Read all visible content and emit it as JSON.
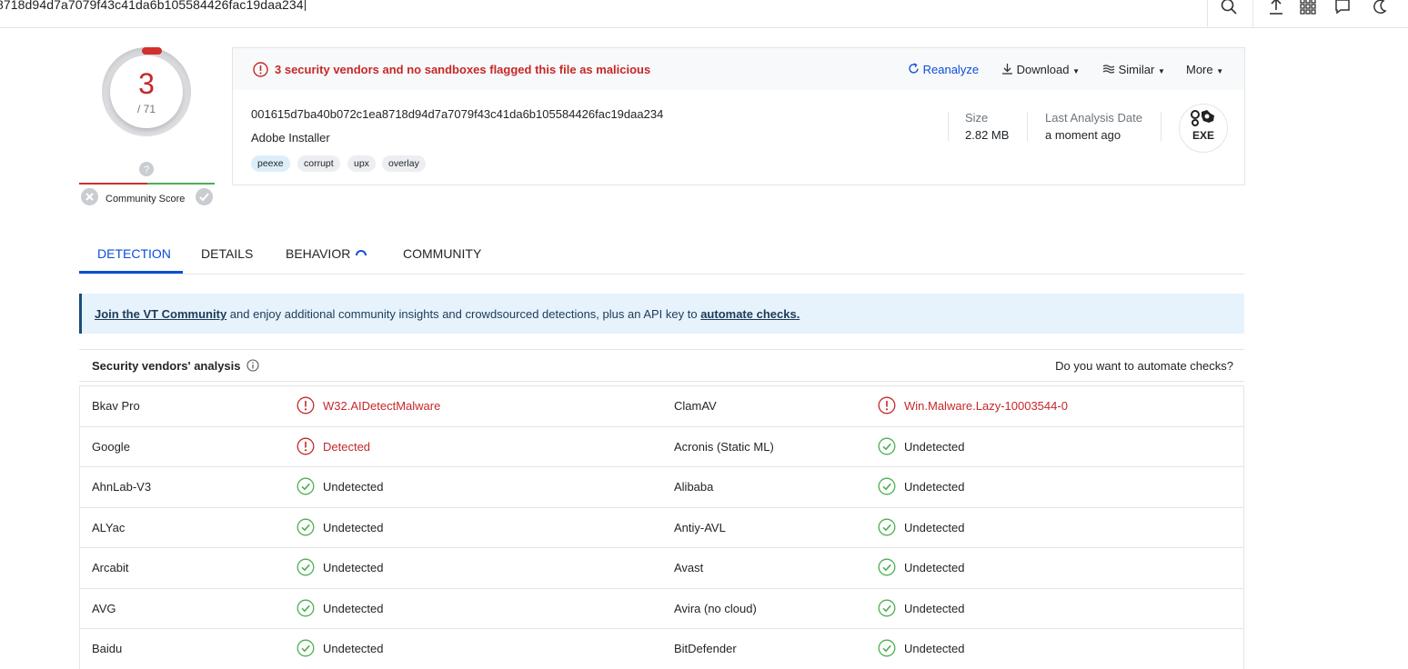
{
  "topbar": {
    "search_value": "8718d94d7a7079f43c41da6b105584426fac19daa234",
    "icons": [
      "search-icon",
      "upload-icon",
      "apps-grid-icon",
      "chat-icon",
      "theme-icon"
    ]
  },
  "score": {
    "detections": "3",
    "total": "/ 71",
    "community_label": "Community Score"
  },
  "summary": {
    "alert": "3 security vendors and no sandboxes flagged this file as malicious",
    "actions": {
      "reanalyze": "Reanalyze",
      "download": "Download",
      "similar": "Similar",
      "more": "More"
    },
    "hash": "001615d7ba40b072c1ea8718d94d7a7079f43c41da6b105584426fac19daa234",
    "filename": "Adobe Installer",
    "tags": [
      "peexe",
      "corrupt",
      "upx",
      "overlay"
    ],
    "size_label": "Size",
    "size_value": "2.82 MB",
    "date_label": "Last Analysis Date",
    "date_value": "a moment ago",
    "filetype": "EXE"
  },
  "tabs": [
    "DETECTION",
    "DETAILS",
    "BEHAVIOR",
    "COMMUNITY"
  ],
  "banner": {
    "link1": "Join the VT Community",
    "middle": " and enjoy additional community insights and crowdsourced detections, plus an API key to ",
    "link2": "automate checks."
  },
  "vendors": {
    "title": "Security vendors' analysis",
    "right_text": "Do you want to automate checks?",
    "rows": [
      {
        "l_name": "Bkav Pro",
        "l_result": "W32.AIDetectMalware",
        "l_status": "mal",
        "r_name": "ClamAV",
        "r_result": "Win.Malware.Lazy-10003544-0",
        "r_status": "mal"
      },
      {
        "l_name": "Google",
        "l_result": "Detected",
        "l_status": "mal",
        "r_name": "Acronis (Static ML)",
        "r_result": "Undetected",
        "r_status": "ok"
      },
      {
        "l_name": "AhnLab-V3",
        "l_result": "Undetected",
        "l_status": "ok",
        "r_name": "Alibaba",
        "r_result": "Undetected",
        "r_status": "ok"
      },
      {
        "l_name": "ALYac",
        "l_result": "Undetected",
        "l_status": "ok",
        "r_name": "Antiy-AVL",
        "r_result": "Undetected",
        "r_status": "ok"
      },
      {
        "l_name": "Arcabit",
        "l_result": "Undetected",
        "l_status": "ok",
        "r_name": "Avast",
        "r_result": "Undetected",
        "r_status": "ok"
      },
      {
        "l_name": "AVG",
        "l_result": "Undetected",
        "l_status": "ok",
        "r_name": "Avira (no cloud)",
        "r_result": "Undetected",
        "r_status": "ok"
      },
      {
        "l_name": "Baidu",
        "l_result": "Undetected",
        "l_status": "ok",
        "r_name": "BitDefender",
        "r_result": "Undetected",
        "r_status": "ok"
      }
    ]
  },
  "colors": {
    "malicious": "#c62828",
    "clean": "#4caf50",
    "accent": "#0b4dda"
  }
}
